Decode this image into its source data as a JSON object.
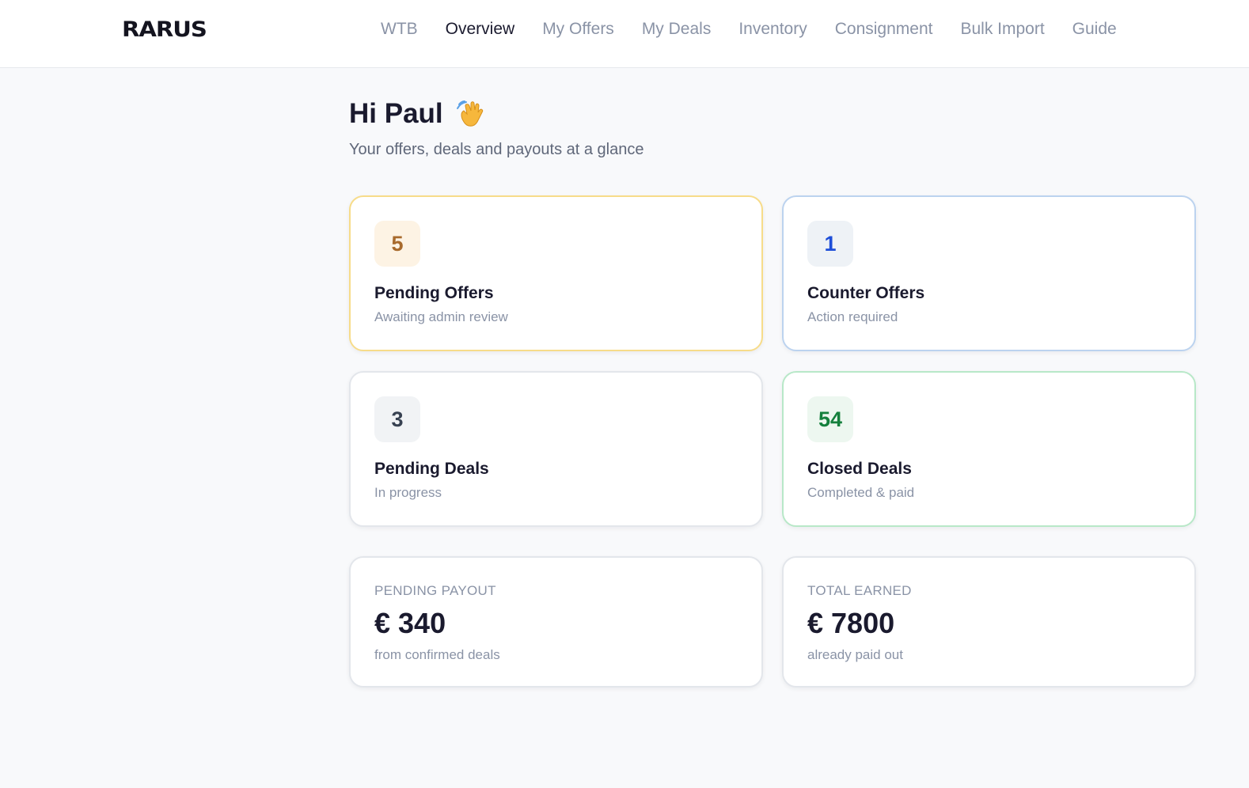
{
  "header": {
    "logo": "RARUS",
    "nav": [
      "WTB",
      "Overview",
      "My Offers",
      "My Deals",
      "Inventory",
      "Consignment",
      "Bulk Import",
      "Guide"
    ],
    "active_nav": "Overview"
  },
  "greeting": {
    "title": "Hi Paul",
    "subtitle": "Your offers, deals and payouts at a glance"
  },
  "stats": [
    {
      "count": "5",
      "title": "Pending Offers",
      "sub": "Awaiting admin review",
      "color": "#a86a2c",
      "badge_bg": "#fdf3e4"
    },
    {
      "count": "1",
      "title": "Counter Offers",
      "sub": "Action required",
      "color": "#1d4ed8",
      "badge_bg": "#eef2f6"
    },
    {
      "count": "3",
      "title": "Pending Deals",
      "sub": "In progress",
      "color": "#374151",
      "badge_bg": "#f1f3f5"
    },
    {
      "count": "54",
      "title": "Closed Deals",
      "sub": "Completed & paid",
      "color": "#15803d",
      "badge_bg": "#edf7f0"
    }
  ],
  "payouts": [
    {
      "label": "PENDING PAYOUT",
      "value": "€ 340",
      "note": "from confirmed deals"
    },
    {
      "label": "TOTAL EARNED",
      "value": "€ 7800",
      "note": "already paid out"
    }
  ]
}
